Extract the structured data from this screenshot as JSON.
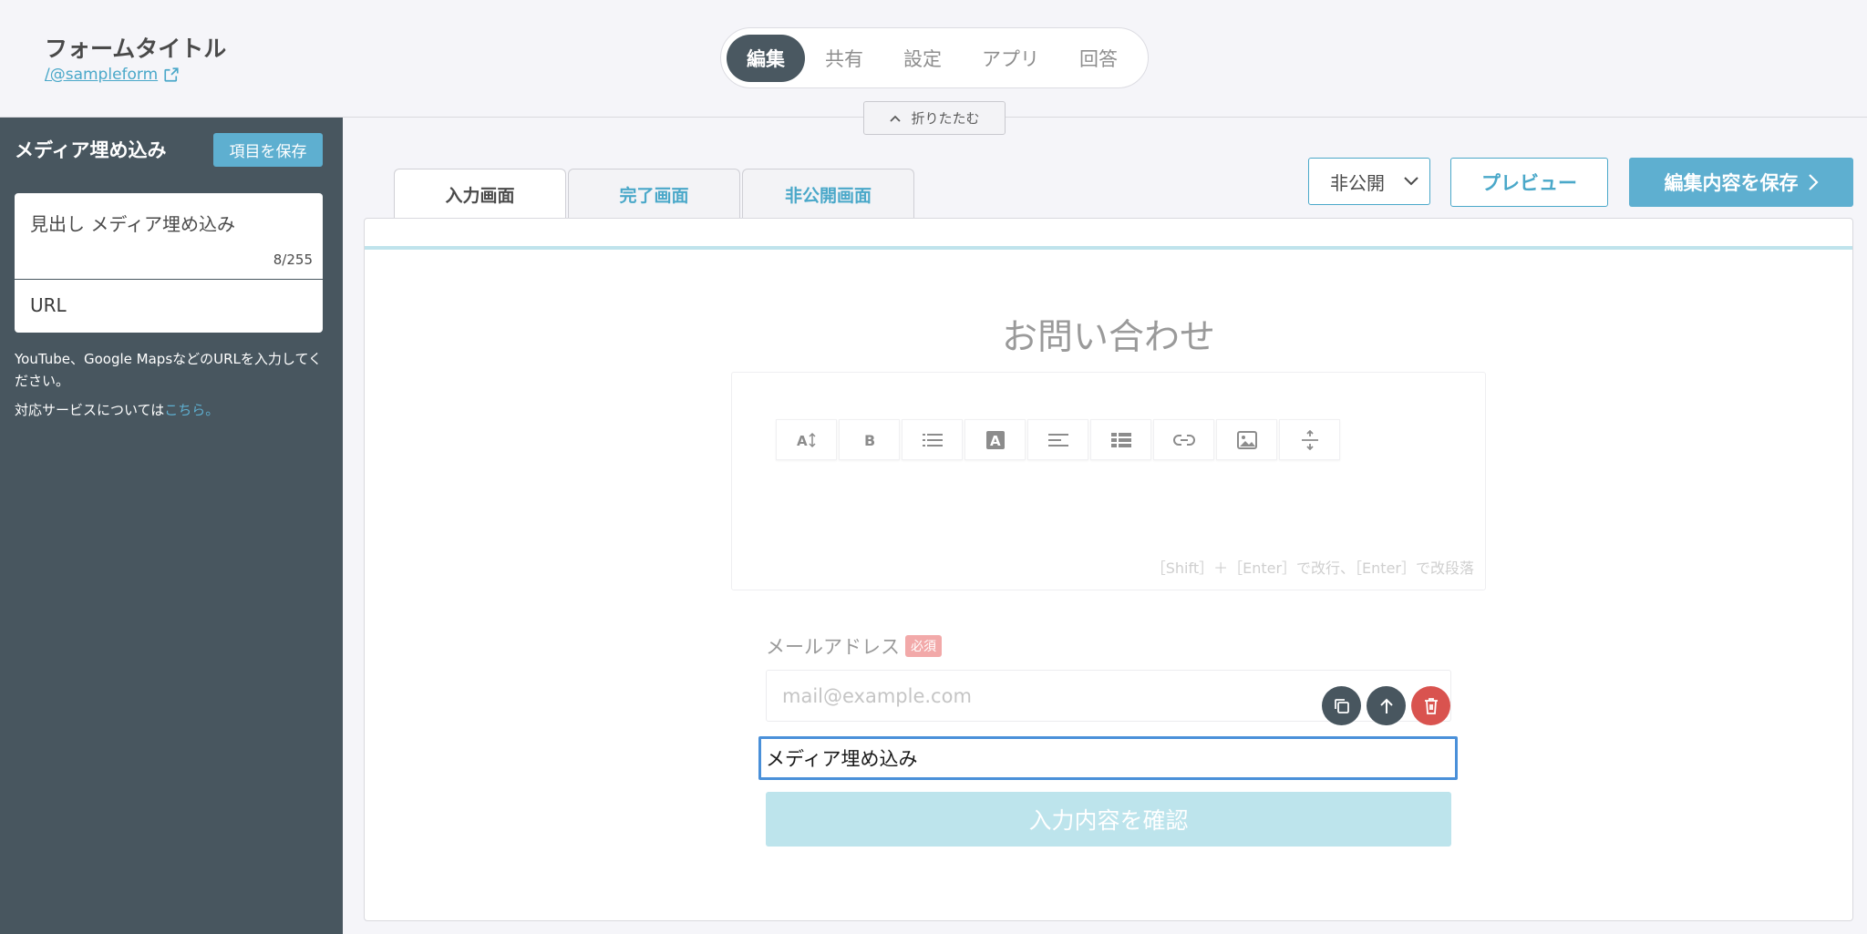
{
  "header": {
    "form_title": "フォームタイトル",
    "form_url": "/@sampleform",
    "nav": [
      "編集",
      "共有",
      "設定",
      "アプリ",
      "回答"
    ],
    "collapse_label": "折りたたむ"
  },
  "sidebar": {
    "title": "メディア埋め込み",
    "save_item_label": "項目を保存",
    "heading_field": "見出し  メディア埋め込み",
    "heading_count": "8/255",
    "url_label": "URL",
    "help_text": "YouTube、Google MapsなどのURLを入力してください。",
    "help_text2_prefix": "対応サービスについては",
    "help_link": "こちら",
    "help_text2_suffix": "。"
  },
  "main": {
    "tabs": [
      "入力画面",
      "完了画面",
      "非公開画面"
    ],
    "visibility": "非公開",
    "preview_label": "プレビュー",
    "save_label": "編集内容を保存",
    "form_heading": "お問い合わせ",
    "toolbar_icons": [
      "text-size-icon",
      "bold-icon",
      "list-icon",
      "text-color-icon",
      "align-icon",
      "table-icon",
      "link-icon",
      "image-icon",
      "divider-icon"
    ],
    "editor_hint": "［Shift］＋［Enter］で改行、［Enter］で改段落",
    "email_label": "メールアドレス",
    "required_label": "必須",
    "email_placeholder": "mail@example.com",
    "media_block_label": "メディア埋め込み",
    "confirm_label": "入力内容を確認"
  },
  "colors": {
    "accent": "#5eafd0",
    "sidebar_bg": "#48565f",
    "danger": "#d9534f",
    "selection": "#4a90d9"
  }
}
